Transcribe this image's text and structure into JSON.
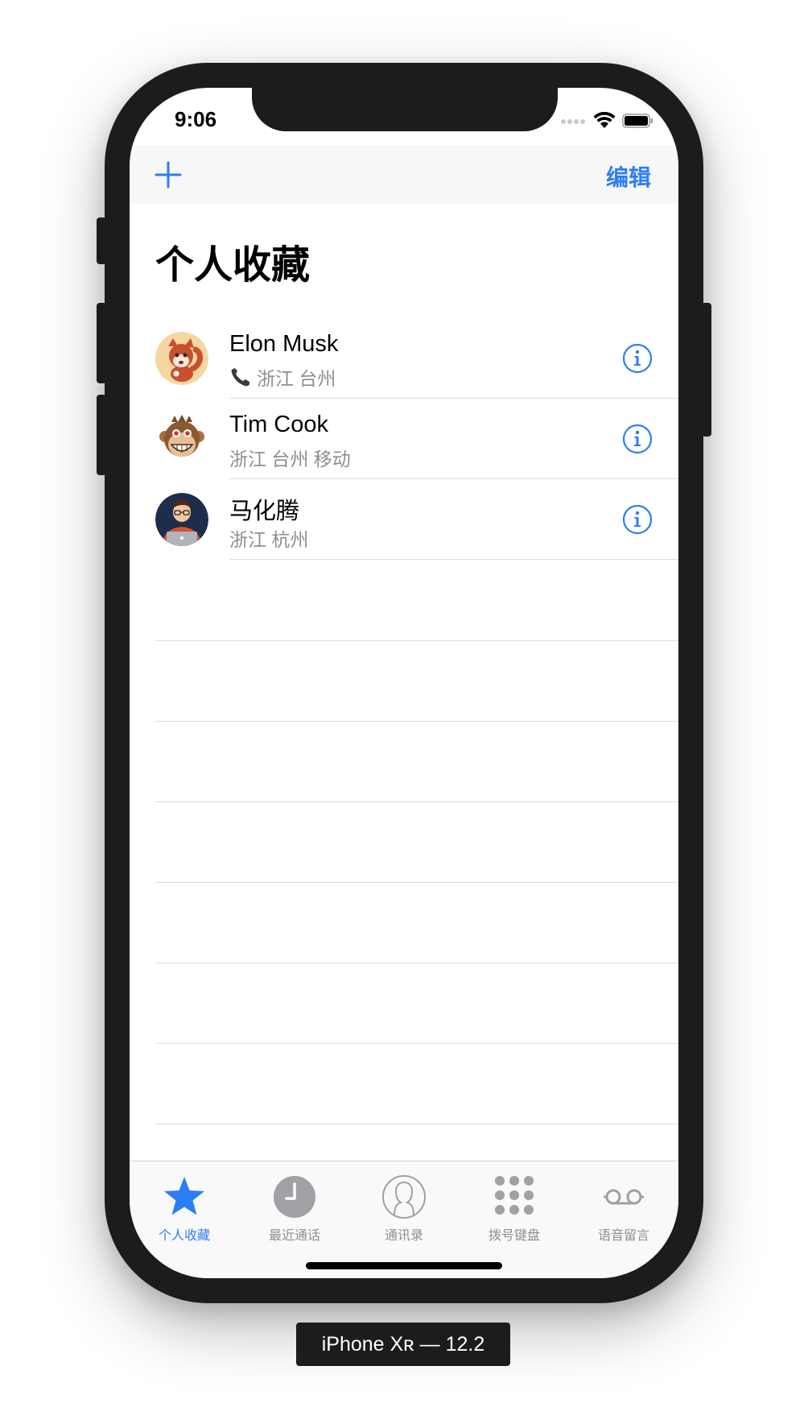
{
  "status_bar": {
    "time": "9:06"
  },
  "nav_bar": {
    "edit_label": "编辑"
  },
  "page": {
    "title": "个人收藏"
  },
  "contacts": [
    {
      "name": "Elon Musk",
      "subtitle": "浙江 台州",
      "has_phone_icon": true
    },
    {
      "name": "Tim Cook",
      "subtitle": "浙江 台州 移动",
      "has_phone_icon": false
    },
    {
      "name": "马化腾",
      "subtitle": "浙江 杭州",
      "has_phone_icon": false
    }
  ],
  "tab_bar": {
    "items": [
      {
        "label": "个人收藏",
        "icon": "star-icon",
        "active": true
      },
      {
        "label": "最近通话",
        "icon": "clock-icon",
        "active": false
      },
      {
        "label": "通讯录",
        "icon": "contacts-icon",
        "active": false
      },
      {
        "label": "拨号键盘",
        "icon": "keypad-icon",
        "active": false
      },
      {
        "label": "语音留言",
        "icon": "voicemail-icon",
        "active": false
      }
    ]
  },
  "device": {
    "label": "iPhone Xʀ — 12.2"
  },
  "colors": {
    "accent": "#2c7ef5",
    "secondary_text": "#8e8e93",
    "separator": "#dcdcdc",
    "bezel": "#1c1c1c"
  }
}
